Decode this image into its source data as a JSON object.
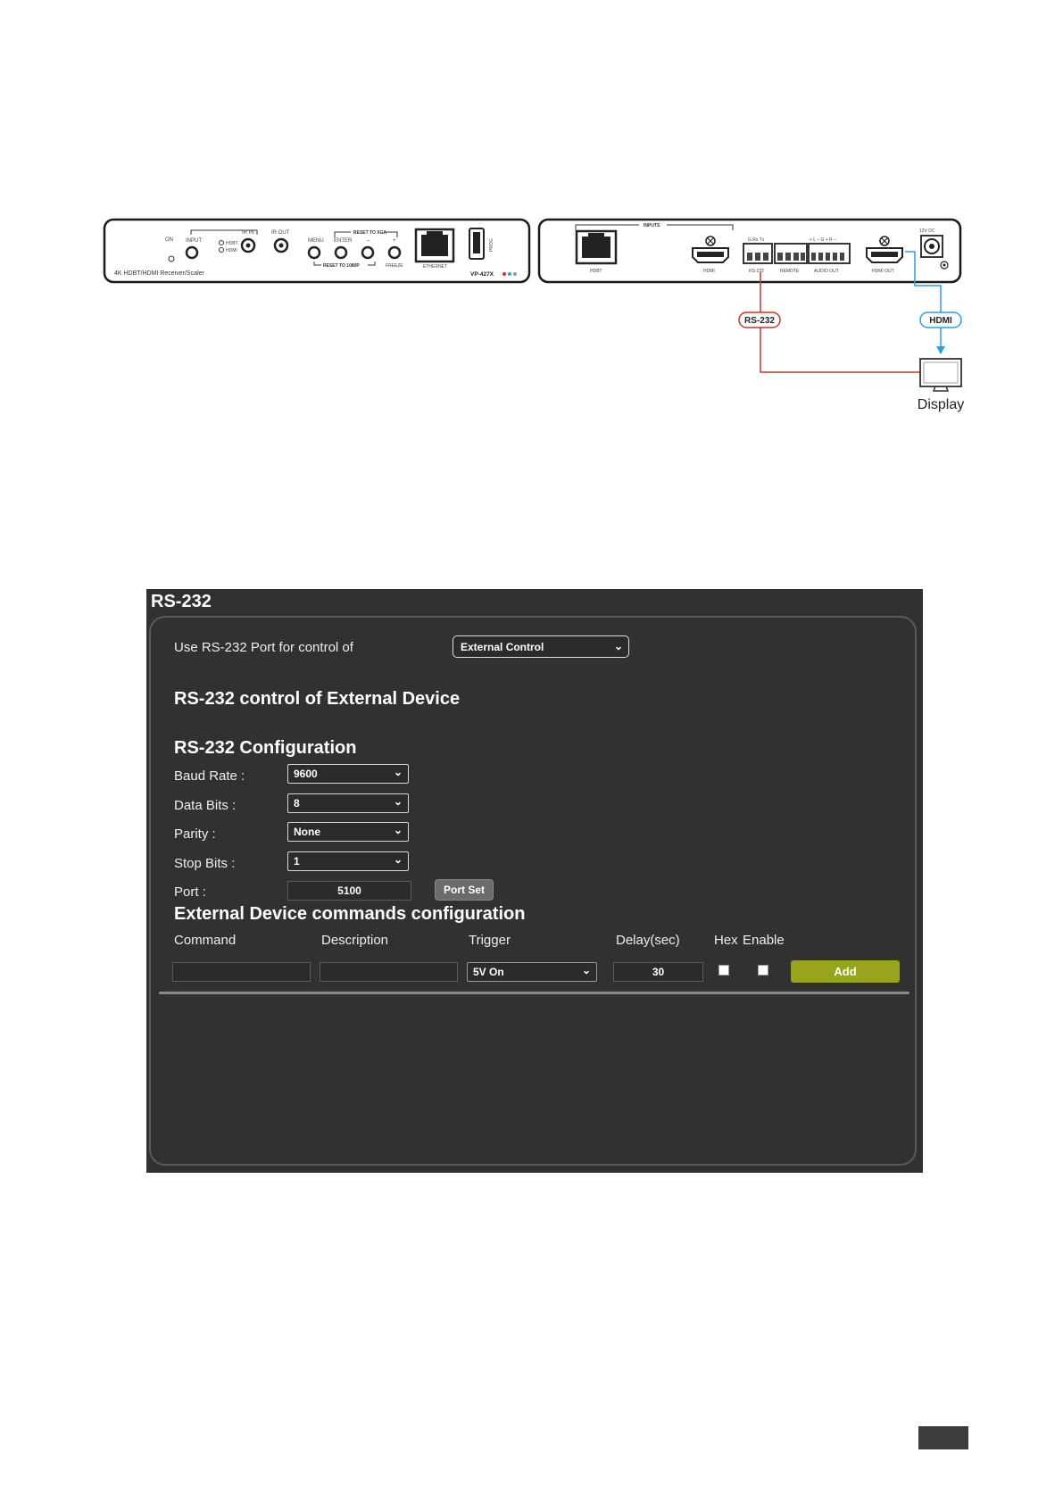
{
  "diagram": {
    "front_panel": {
      "device_name": "4K HDBT/HDMI Receiver/Scaler",
      "model": "VP-427X",
      "labels": {
        "on": "ON",
        "input": "INPUT",
        "hdbt": "HDBT",
        "hdmi_led": "HDMI",
        "ir_in": "IR IN",
        "ir_out": "IR OUT",
        "menu": "MENU",
        "enter": "ENTER",
        "minus": "–",
        "plus": "+",
        "freeze": "FREEZE",
        "reset_to_xga": "RESET TO XGA",
        "reset_to_1080p": "RESET TO 1080P",
        "ethernet": "ETHERNET",
        "prog": "PROG"
      }
    },
    "rear_panel": {
      "labels": {
        "inputs": "INPUTS",
        "hdbt": "HDBT",
        "hdmi": "HDMI",
        "rs232": "RS-232",
        "rs232_pins": "G Rx Tx",
        "remote": "REMOTE",
        "audio_out": "AUDIO OUT",
        "audio_pins": "+ L –  G  + R –",
        "hdmi_out": "HDMI OUT",
        "power": "12V DC"
      }
    },
    "connection_labels": {
      "rs232": "RS-232",
      "hdmi": "HDMI"
    },
    "display_label": "Display",
    "colors": {
      "rs232_line": "#c0392b",
      "hdmi_line": "#2f9fd8"
    }
  },
  "ui": {
    "title": "RS-232",
    "control_label": "Use RS-232 Port for control of",
    "control_value": "External Control",
    "heading_external": "RS-232 control of External Device",
    "heading_config": "RS-232 Configuration",
    "baud_rate_label": "Baud Rate :",
    "baud_rate_value": "9600",
    "data_bits_label": "Data Bits :",
    "data_bits_value": "8",
    "parity_label": "Parity :",
    "parity_value": "None",
    "stop_bits_label": "Stop Bits :",
    "stop_bits_value": "1",
    "port_label": "Port :",
    "port_value": "5100",
    "port_set_button": "Port Set",
    "heading_commands": "External Device commands configuration",
    "columns": [
      "Command",
      "Description",
      "Trigger",
      "Delay(sec)",
      "Hex",
      "Enable"
    ],
    "trigger_value": "5V On",
    "delay_value": "30",
    "add_button": "Add",
    "colors": {
      "background": "#313131",
      "add_button": "#98a51c"
    }
  }
}
